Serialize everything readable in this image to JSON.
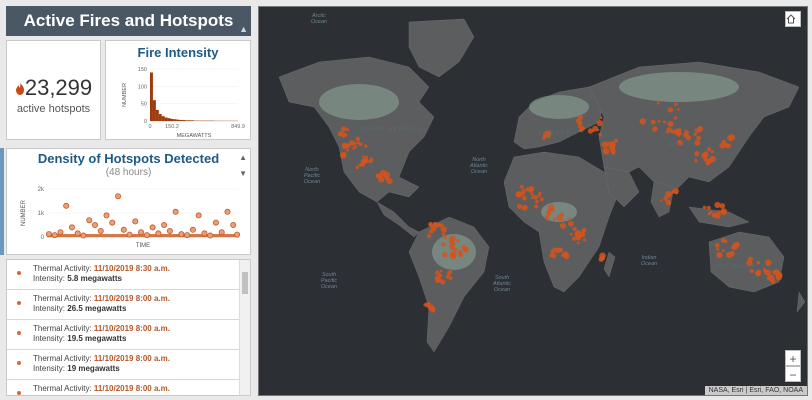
{
  "header": {
    "title": "Active Fires and Hotspots"
  },
  "hotspots": {
    "count": "23,299",
    "label": "active hotspots",
    "icon": "flame-icon"
  },
  "intensity_panel": {
    "title": "Fire Intensity"
  },
  "density_panel": {
    "title": "Density of Hotspots Detected",
    "subtitle": "(48 hours)"
  },
  "chart_data": [
    {
      "type": "bar",
      "title": "Fire Intensity",
      "xlabel": "MEGAWATTS",
      "ylabel": "NUMBER",
      "x_ticks": [
        "0",
        "150.2",
        "849.9"
      ],
      "y_ticks": [
        "0",
        "50",
        "100",
        "150"
      ],
      "ylim": [
        0,
        150
      ],
      "color": "#9e3a0e",
      "values": [
        140,
        60,
        32,
        20,
        14,
        10,
        8,
        6,
        5,
        4,
        3,
        3,
        2,
        2,
        2,
        1,
        1,
        1,
        1,
        1,
        1,
        1,
        0.5,
        0.5,
        0.5,
        0.5,
        0.5,
        0.5,
        0.5,
        0.5
      ]
    },
    {
      "type": "scatter",
      "title": "Density of Hotspots Detected",
      "xlabel": "TIME",
      "ylabel": "NUMBER",
      "y_ticks": [
        "0",
        "1k",
        "2k"
      ],
      "ylim": [
        0,
        2000
      ],
      "color": "#c8581f",
      "points": [
        {
          "x": 1,
          "y": 120
        },
        {
          "x": 4,
          "y": 80
        },
        {
          "x": 7,
          "y": 200
        },
        {
          "x": 10,
          "y": 1300
        },
        {
          "x": 13,
          "y": 400
        },
        {
          "x": 16,
          "y": 150
        },
        {
          "x": 19,
          "y": 60
        },
        {
          "x": 22,
          "y": 700
        },
        {
          "x": 25,
          "y": 500
        },
        {
          "x": 28,
          "y": 250
        },
        {
          "x": 31,
          "y": 900
        },
        {
          "x": 34,
          "y": 600
        },
        {
          "x": 37,
          "y": 1700
        },
        {
          "x": 40,
          "y": 300
        },
        {
          "x": 43,
          "y": 100
        },
        {
          "x": 46,
          "y": 650
        },
        {
          "x": 49,
          "y": 200
        },
        {
          "x": 52,
          "y": 80
        },
        {
          "x": 55,
          "y": 400
        },
        {
          "x": 58,
          "y": 150
        },
        {
          "x": 61,
          "y": 500
        },
        {
          "x": 64,
          "y": 250
        },
        {
          "x": 67,
          "y": 1050
        },
        {
          "x": 70,
          "y": 120
        },
        {
          "x": 73,
          "y": 80
        },
        {
          "x": 76,
          "y": 300
        },
        {
          "x": 79,
          "y": 900
        },
        {
          "x": 82,
          "y": 150
        },
        {
          "x": 85,
          "y": 60
        },
        {
          "x": 88,
          "y": 600
        },
        {
          "x": 91,
          "y": 200
        },
        {
          "x": 94,
          "y": 1050
        },
        {
          "x": 97,
          "y": 500
        },
        {
          "x": 99,
          "y": 100
        }
      ]
    }
  ],
  "list": {
    "items": [
      {
        "prefix": "Thermal Activity: ",
        "timestamp": "11/10/2019 8:30 a.m.",
        "intensity_prefix": "Intensity: ",
        "intensity": "5.8 megawatts"
      },
      {
        "prefix": "Thermal Activity: ",
        "timestamp": "11/10/2019 8:00 a.m.",
        "intensity_prefix": "Intensity: ",
        "intensity": "26.5 megawatts"
      },
      {
        "prefix": "Thermal Activity: ",
        "timestamp": "11/10/2019 8:00 a.m.",
        "intensity_prefix": "Intensity: ",
        "intensity": "19.5 megawatts"
      },
      {
        "prefix": "Thermal Activity: ",
        "timestamp": "11/10/2019 8:00 a.m.",
        "intensity_prefix": "Intensity: ",
        "intensity": "19 megawatts"
      },
      {
        "prefix": "Thermal Activity: ",
        "timestamp": "11/10/2019 8:00 a.m.",
        "intensity_prefix": "Intensity: ",
        "intensity": "17.6 megawatts"
      }
    ]
  },
  "map": {
    "home_icon": "home-icon",
    "zoom_in": "+",
    "zoom_out": "−",
    "attribution": "NASA, Esri | Esri, FAO, NOAA",
    "labels": {
      "north_america": "NORTH AMERICA",
      "europe": "EUROPE",
      "asia": "ASIA",
      "australia": "AUSTRALIA",
      "north_pacific": "North Pacific Ocean",
      "north_atlantic": "North Atlantic Ocean",
      "south_pacific": "South Pacific Ocean",
      "south_atlantic": "South Atlantic Ocean",
      "indian": "Indian Ocean",
      "arctic": "Arctic Ocean"
    },
    "colors": {
      "ocean": "#2c2f33",
      "land": "#5b5d5f",
      "forest": "#8fa89a",
      "hotspot": "#d4541c"
    }
  }
}
